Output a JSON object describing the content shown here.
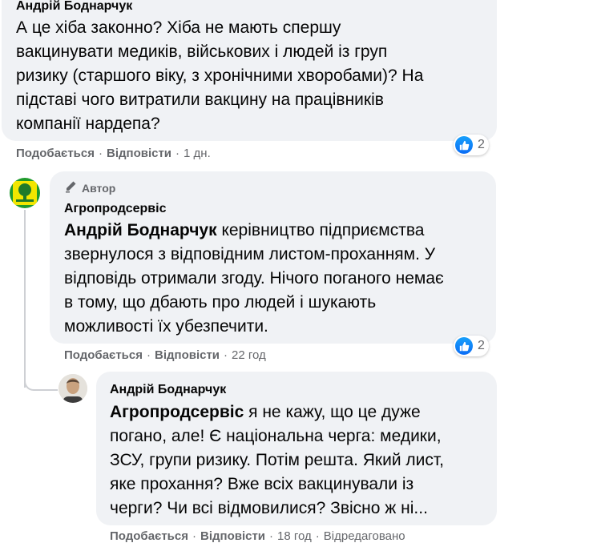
{
  "comments": [
    {
      "author": "Андрій Боднарчук",
      "lines": [
        "А це хіба законно? Хіба не мають спершу",
        "вакцинувати медиків, військових і людей із груп",
        "ризику (старшого віку, з хронічними хворобами)? На",
        "підставі чого витратили вакцину на працівників",
        "компанії нардепа?"
      ],
      "actions": {
        "like": "Подобається",
        "reply": "Відповісти",
        "time": "1 дн."
      },
      "reactions": "2"
    },
    {
      "author_badge": "Автор",
      "author": "Агропродсервіс",
      "mention": "Андрій Боднарчук",
      "line1_rest": " керівництво підприємства",
      "lines": [
        "звернулося з відповідним листом-проханням. У",
        "відповідь отримали згоду. Нічого поганого немає",
        "в тому, що дбають про людей і шукають",
        "можливості їх убезпечити."
      ],
      "actions": {
        "like": "Подобається",
        "reply": "Відповісти",
        "time": "22 год"
      },
      "reactions": "2"
    },
    {
      "author": "Андрій Боднарчук",
      "mention": "Агропродсервіс",
      "line1_rest": " я не кажу, що це дуже",
      "lines": [
        "погано, але! Є національна черга: медики,",
        "ЗСУ, групи ризику. Потім решта. Який лист,",
        "яке прохання? Вже всіх вакцинували із",
        "черги? Чи всі відмовилися? Звісно ж ні..."
      ],
      "actions": {
        "like": "Подобається",
        "reply": "Відповісти",
        "time": "18 год",
        "edited": "Відредаговано"
      }
    }
  ],
  "colors": {
    "bubble": "#f0f2f5",
    "meta": "#65676b",
    "like": "#1877f2"
  },
  "icons": {
    "like": "like-icon",
    "pencil": "pencil-icon"
  }
}
